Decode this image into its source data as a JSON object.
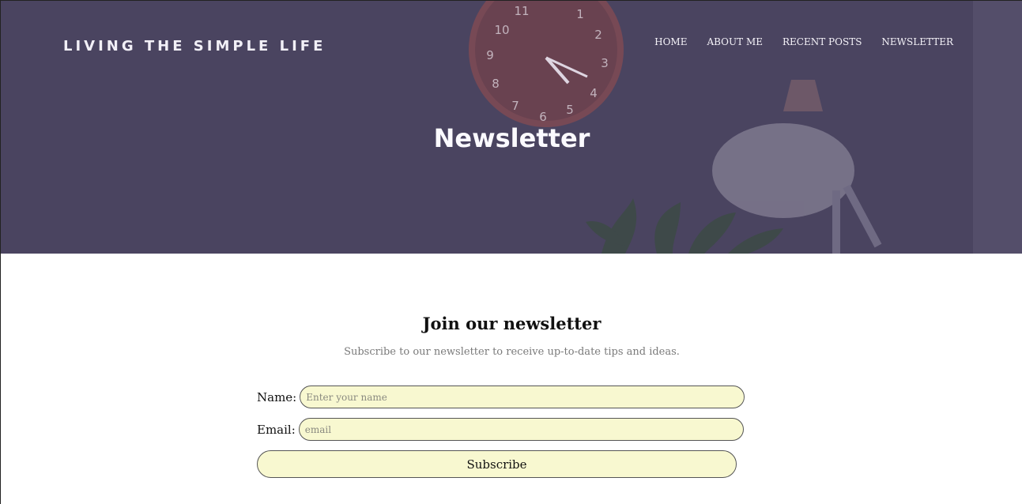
{
  "site": {
    "brand": "LIVING THE SIMPLE LIFE",
    "nav": [
      {
        "label": "HOME"
      },
      {
        "label": "ABOUT ME"
      },
      {
        "label": "RECENT POSTS"
      },
      {
        "label": "NEWSLETTER"
      }
    ]
  },
  "hero": {
    "title": "Newsletter",
    "overlay_color": "#4a4460"
  },
  "newsletter": {
    "heading": "Join our newsletter",
    "subtitle": "Subscribe to our newsletter to receive up-to-date tips and ideas.",
    "name_label": "Name:",
    "name_placeholder": "Enter your name",
    "email_label": "Email:",
    "email_placeholder": "email",
    "button_label": "Subscribe",
    "field_color": "#f8f8d0"
  }
}
